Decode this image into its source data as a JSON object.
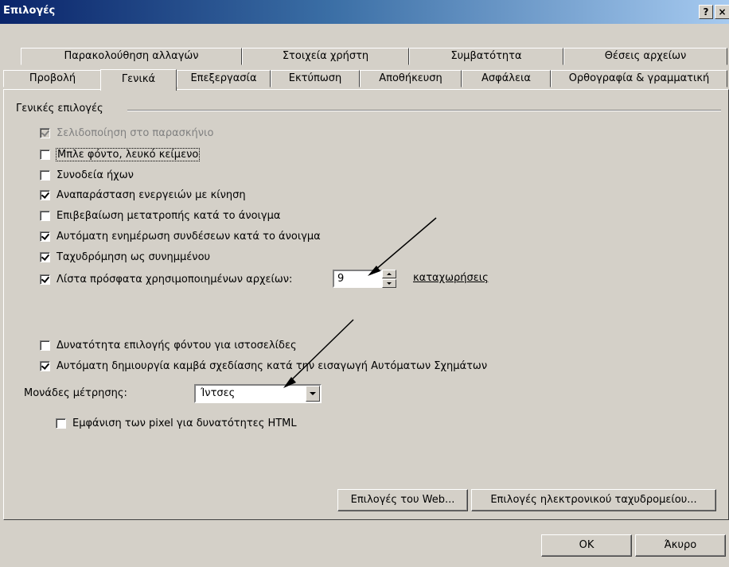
{
  "window": {
    "title": "Επιλογές",
    "help_glyph": "?",
    "close_glyph": "×"
  },
  "tabs_back": [
    "Παρακολούθηση αλλαγών",
    "Στοιχεία χρήστη",
    "Συμβατότητα",
    "Θέσεις αρχείων"
  ],
  "tabs_front": [
    "Προβολή",
    "Γενικά",
    "Επεξεργασία",
    "Εκτύπωση",
    "Αποθήκευση",
    "Ασφάλεια",
    "Ορθογραφία & γραμματική"
  ],
  "selected_tab": "Γενικά",
  "group": {
    "title": "Γενικές επιλογές"
  },
  "options": [
    {
      "label": "Σελιδοποίηση στο παρασκήνιο",
      "checked": true,
      "disabled": true
    },
    {
      "label": "Μπλε φόντο, λευκό κείμενο",
      "checked": false,
      "disabled": false
    },
    {
      "label": "Συνοδεία ήχων",
      "checked": false,
      "disabled": false
    },
    {
      "label": "Αναπαράσταση ενεργειών με κίνηση",
      "checked": true,
      "disabled": false
    },
    {
      "label": "Επιβεβαίωση μετατροπής κατά το άνοιγμα",
      "checked": false,
      "disabled": false
    },
    {
      "label": "Αυτόματη ενημέρωση συνδέσεων κατά το άνοιγμα",
      "checked": true,
      "disabled": false
    },
    {
      "label": "Ταχυδρόμηση ως συνημμένου",
      "checked": true,
      "disabled": false
    },
    {
      "label": "Λίστα πρόσφατα χρησιμοποιημένων αρχείων:",
      "checked": true,
      "disabled": false
    },
    {
      "label": "Δυνατότητα επιλογής φόντου για ιστοσελίδες",
      "checked": false,
      "disabled": false
    },
    {
      "label": "Αυτόματη δημιουργία καμβά σχεδίασης κατά την εισαγωγή Αυτόματων Σχημάτων",
      "checked": true,
      "disabled": false
    }
  ],
  "recent_files": {
    "value": "9",
    "suffix": "καταχωρήσεις"
  },
  "units": {
    "label": "Μονάδες μέτρησης:",
    "value": "Ίντσες"
  },
  "html_pixels": {
    "label": "Εμφάνιση των pixel για δυνατότητες HTML",
    "checked": false
  },
  "buttons": {
    "web_options": "Επιλογές του Web...",
    "email_options": "Επιλογές ηλεκτρονικού ταχυδρομείου...",
    "ok": "OK",
    "cancel": "Άκυρο"
  }
}
